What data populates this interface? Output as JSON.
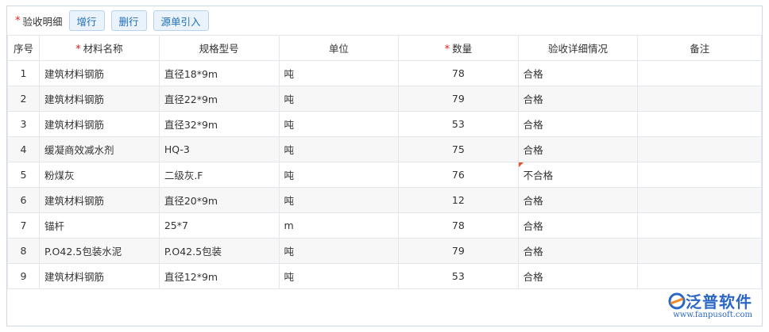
{
  "toolbar": {
    "required_mark": "*",
    "title": "验收明细",
    "add_row": "增行",
    "delete_row": "删行",
    "import_source": "源单引入"
  },
  "columns": {
    "seq": "序号",
    "material_name": "材料名称",
    "spec": "规格型号",
    "unit": "单位",
    "quantity": "数量",
    "detail": "验收详细情况",
    "remark": "备注"
  },
  "rows": [
    {
      "seq": "1",
      "name": "建筑材料钢筋",
      "spec": "直径18*9m",
      "unit": "吨",
      "qty": "78",
      "detail": "合格",
      "remark": ""
    },
    {
      "seq": "2",
      "name": "建筑材料钢筋",
      "spec": "直径22*9m",
      "unit": "吨",
      "qty": "79",
      "detail": "合格",
      "remark": ""
    },
    {
      "seq": "3",
      "name": "建筑材料钢筋",
      "spec": "直径32*9m",
      "unit": "吨",
      "qty": "53",
      "detail": "合格",
      "remark": ""
    },
    {
      "seq": "4",
      "name": "缓凝商效减水剂",
      "spec": "HQ-3",
      "unit": "吨",
      "qty": "75",
      "detail": "合格",
      "remark": ""
    },
    {
      "seq": "5",
      "name": "粉煤灰",
      "spec": "二级灰.F",
      "unit": "吨",
      "qty": "76",
      "detail": "不合格",
      "remark": ""
    },
    {
      "seq": "6",
      "name": "建筑材料钢筋",
      "spec": "直径20*9m",
      "unit": "吨",
      "qty": "12",
      "detail": "合格",
      "remark": ""
    },
    {
      "seq": "7",
      "name": "锚杆",
      "spec": "25*7",
      "unit": "m",
      "qty": "78",
      "detail": "合格",
      "remark": ""
    },
    {
      "seq": "8",
      "name": "P.O42.5包装水泥",
      "spec": "P.O42.5包装",
      "unit": "吨",
      "qty": "79",
      "detail": "合格",
      "remark": ""
    },
    {
      "seq": "9",
      "name": "建筑材料钢筋",
      "spec": "直径12*9m",
      "unit": "吨",
      "qty": "53",
      "detail": "合格",
      "remark": ""
    }
  ],
  "logo": {
    "name": "泛普软件",
    "url": "www.fanpusoft.com"
  },
  "colors": {
    "accent": "#1d6fb8",
    "required": "#e02020",
    "logo": "#2b67c4"
  }
}
